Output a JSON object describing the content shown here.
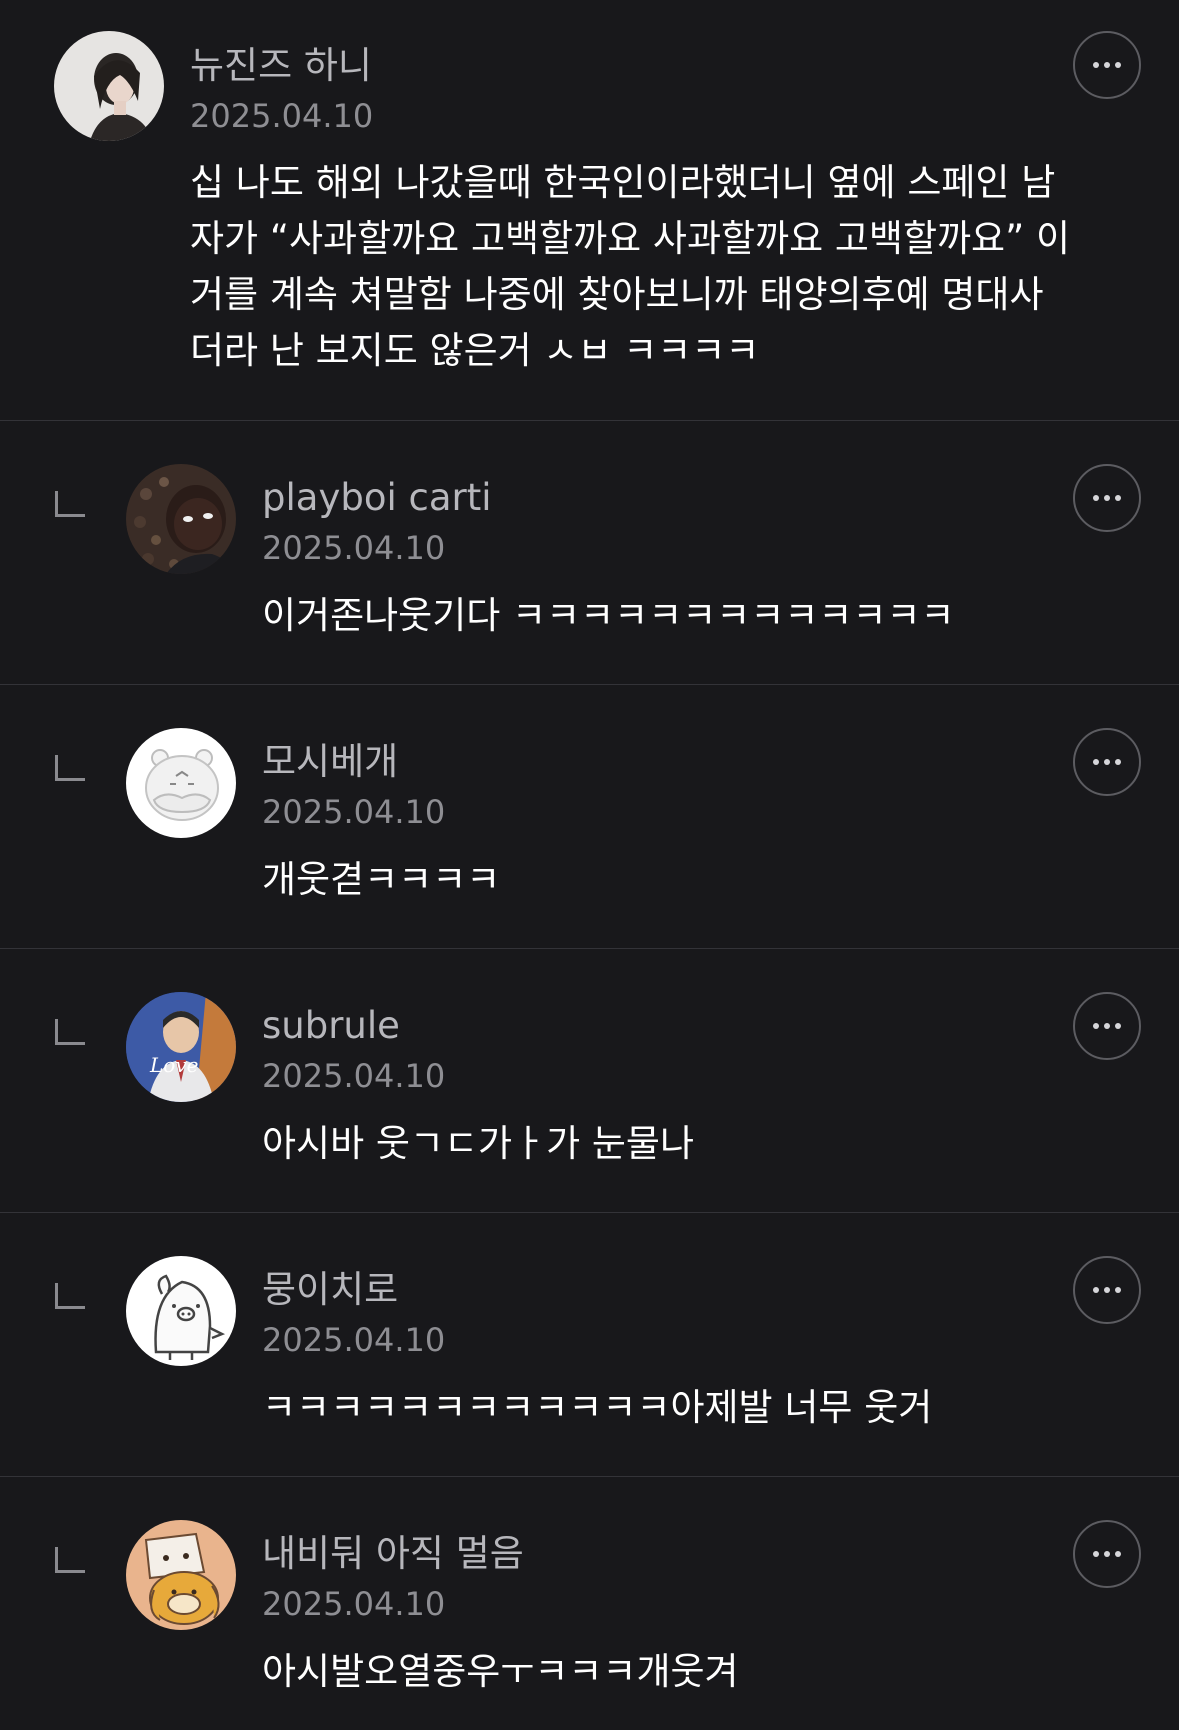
{
  "comments": [
    {
      "username": "뉴진즈 하니",
      "date": "2025.04.10",
      "lines": [
        "십 나도 해외 나갔을때 한국인이라했더니 옆에 스페인 남",
        "자가 “사과할까요 고백할까요 사과할까요 고백할까요” 이",
        "거를 계속 쳐말함 나중에 찾아보니까 태양의후예 명대사",
        "더라 난 보지도 않은거 ㅅㅂ ㅋㅋㅋㅋ"
      ],
      "avatar_icon": "profile-photo-woman-icon"
    },
    {
      "username": "playboi carti",
      "date": "2025.04.10",
      "text": "이거존나웃기다 ㅋㅋㅋㅋㅋㅋㅋㅋㅋㅋㅋㅋㅋ",
      "avatar_icon": "profile-photo-man-icon"
    },
    {
      "username": "모시베개",
      "date": "2025.04.10",
      "text": "개웃겯ㅋㅋㅋㅋ",
      "avatar_icon": "cartoon-hamster-icon"
    },
    {
      "username": "subrule",
      "date": "2025.04.10",
      "text": "아시바 웃ㄱㄷ가ㅏ가 눈물나",
      "avatar_icon": "profile-photo-man-love-icon"
    },
    {
      "username": "뭉이치로",
      "date": "2025.04.10",
      "text": "ㅋㅋㅋㅋㅋㅋㅋㅋㅋㅋㅋㅋ아제발 너무 웃거",
      "avatar_icon": "cartoon-pig-icon"
    },
    {
      "username": "내비둬 아직 멀음",
      "date": "2025.04.10",
      "text": "아시발오열중우ㅜㅋㅋㅋ개웃겨",
      "avatar_icon": "cartoon-dog-cat-icon"
    }
  ],
  "colors": {
    "background": "#18181b",
    "divider": "#333338",
    "username": "#b7b7bc",
    "date": "#8e8e93",
    "text": "#ffffff"
  },
  "more_button_icon": "more-horizontal-icon",
  "reply_indicator_icon": "reply-arrow-icon"
}
